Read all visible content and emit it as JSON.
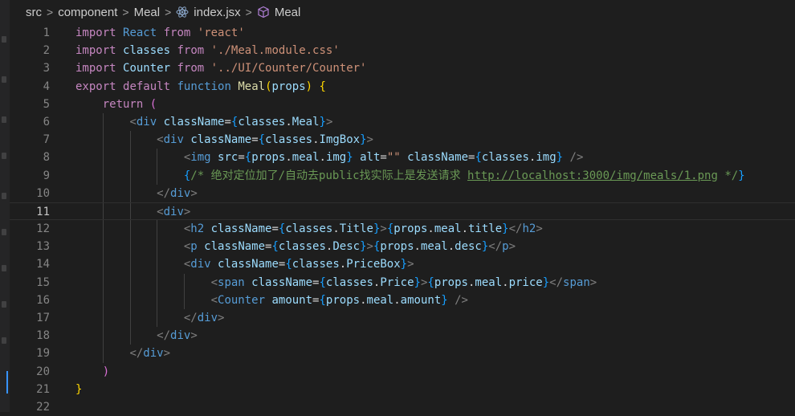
{
  "breadcrumb": {
    "items": [
      "src",
      "component",
      "Meal",
      "index.jsx",
      "Meal"
    ]
  },
  "editor": {
    "current_line": 11,
    "line_numbers": [
      "1",
      "2",
      "3",
      "4",
      "5",
      "6",
      "7",
      "8",
      "9",
      "10",
      "11",
      "12",
      "13",
      "14",
      "15",
      "16",
      "17",
      "18",
      "19",
      "20",
      "21",
      "22"
    ],
    "lines": [
      [
        [
          "kw",
          "import"
        ],
        [
          "plain",
          " "
        ],
        [
          "kw2",
          "React"
        ],
        [
          "plain",
          " "
        ],
        [
          "kw",
          "from"
        ],
        [
          "plain",
          " "
        ],
        [
          "str",
          "'react'"
        ]
      ],
      [
        [
          "kw",
          "import"
        ],
        [
          "plain",
          " "
        ],
        [
          "var",
          "classes"
        ],
        [
          "plain",
          " "
        ],
        [
          "kw",
          "from"
        ],
        [
          "plain",
          " "
        ],
        [
          "str",
          "'./Meal.module.css'"
        ]
      ],
      [
        [
          "kw",
          "import"
        ],
        [
          "plain",
          " "
        ],
        [
          "var",
          "Counter"
        ],
        [
          "plain",
          " "
        ],
        [
          "kw",
          "from"
        ],
        [
          "plain",
          " "
        ],
        [
          "str",
          "'../UI/Counter/Counter'"
        ]
      ],
      [
        [
          "kw",
          "export"
        ],
        [
          "plain",
          " "
        ],
        [
          "kw",
          "default"
        ],
        [
          "plain",
          " "
        ],
        [
          "kw2",
          "function"
        ],
        [
          "plain",
          " "
        ],
        [
          "fn",
          "Meal"
        ],
        [
          "p1",
          "("
        ],
        [
          "var",
          "props"
        ],
        [
          "p1",
          ")"
        ],
        [
          "plain",
          " "
        ],
        [
          "p1",
          "{"
        ]
      ],
      [
        [
          "plain",
          "    "
        ],
        [
          "kw",
          "return"
        ],
        [
          "plain",
          " "
        ],
        [
          "p2",
          "("
        ]
      ],
      [
        [
          "plain",
          "        "
        ],
        [
          "br",
          "<"
        ],
        [
          "tag",
          "div"
        ],
        [
          "plain",
          " "
        ],
        [
          "attr",
          "className"
        ],
        [
          "plain",
          "="
        ],
        [
          "p3",
          "{"
        ],
        [
          "var",
          "classes"
        ],
        [
          "plain",
          "."
        ],
        [
          "var",
          "Meal"
        ],
        [
          "p3",
          "}"
        ],
        [
          "br",
          ">"
        ]
      ],
      [
        [
          "plain",
          "            "
        ],
        [
          "br",
          "<"
        ],
        [
          "tag",
          "div"
        ],
        [
          "plain",
          " "
        ],
        [
          "attr",
          "className"
        ],
        [
          "plain",
          "="
        ],
        [
          "p3",
          "{"
        ],
        [
          "var",
          "classes"
        ],
        [
          "plain",
          "."
        ],
        [
          "var",
          "ImgBox"
        ],
        [
          "p3",
          "}"
        ],
        [
          "br",
          ">"
        ]
      ],
      [
        [
          "plain",
          "                "
        ],
        [
          "br",
          "<"
        ],
        [
          "tag",
          "img"
        ],
        [
          "plain",
          " "
        ],
        [
          "attr",
          "src"
        ],
        [
          "plain",
          "="
        ],
        [
          "p3",
          "{"
        ],
        [
          "var",
          "props"
        ],
        [
          "plain",
          "."
        ],
        [
          "var",
          "meal"
        ],
        [
          "plain",
          "."
        ],
        [
          "var",
          "img"
        ],
        [
          "p3",
          "}"
        ],
        [
          "plain",
          " "
        ],
        [
          "attr",
          "alt"
        ],
        [
          "plain",
          "="
        ],
        [
          "str",
          "\"\""
        ],
        [
          "plain",
          " "
        ],
        [
          "attr",
          "className"
        ],
        [
          "plain",
          "="
        ],
        [
          "p3",
          "{"
        ],
        [
          "var",
          "classes"
        ],
        [
          "plain",
          "."
        ],
        [
          "var",
          "img"
        ],
        [
          "p3",
          "}"
        ],
        [
          "plain",
          " "
        ],
        [
          "br",
          "/>"
        ]
      ],
      [
        [
          "plain",
          "                "
        ],
        [
          "p3",
          "{"
        ],
        [
          "cm",
          "/* 绝对定位加了/自动去public找实际上是发送请求 "
        ],
        [
          "url",
          "http://localhost:3000/img/meals/1.png"
        ],
        [
          "cm",
          " */"
        ],
        [
          "p3",
          "}"
        ]
      ],
      [
        [
          "plain",
          "            "
        ],
        [
          "br",
          "</"
        ],
        [
          "tag",
          "div"
        ],
        [
          "br",
          ">"
        ]
      ],
      [
        [
          "plain",
          "            "
        ],
        [
          "br",
          "<"
        ],
        [
          "tag",
          "div"
        ],
        [
          "br",
          ">"
        ]
      ],
      [
        [
          "plain",
          "                "
        ],
        [
          "br",
          "<"
        ],
        [
          "tag",
          "h2"
        ],
        [
          "plain",
          " "
        ],
        [
          "attr",
          "className"
        ],
        [
          "plain",
          "="
        ],
        [
          "p3",
          "{"
        ],
        [
          "var",
          "classes"
        ],
        [
          "plain",
          "."
        ],
        [
          "var",
          "Title"
        ],
        [
          "p3",
          "}"
        ],
        [
          "br",
          ">"
        ],
        [
          "p3",
          "{"
        ],
        [
          "var",
          "props"
        ],
        [
          "plain",
          "."
        ],
        [
          "var",
          "meal"
        ],
        [
          "plain",
          "."
        ],
        [
          "var",
          "title"
        ],
        [
          "p3",
          "}"
        ],
        [
          "br",
          "</"
        ],
        [
          "tag",
          "h2"
        ],
        [
          "br",
          ">"
        ]
      ],
      [
        [
          "plain",
          "                "
        ],
        [
          "br",
          "<"
        ],
        [
          "tag",
          "p"
        ],
        [
          "plain",
          " "
        ],
        [
          "attr",
          "className"
        ],
        [
          "plain",
          "="
        ],
        [
          "p3",
          "{"
        ],
        [
          "var",
          "classes"
        ],
        [
          "plain",
          "."
        ],
        [
          "var",
          "Desc"
        ],
        [
          "p3",
          "}"
        ],
        [
          "br",
          ">"
        ],
        [
          "p3",
          "{"
        ],
        [
          "var",
          "props"
        ],
        [
          "plain",
          "."
        ],
        [
          "var",
          "meal"
        ],
        [
          "plain",
          "."
        ],
        [
          "var",
          "desc"
        ],
        [
          "p3",
          "}"
        ],
        [
          "br",
          "</"
        ],
        [
          "tag",
          "p"
        ],
        [
          "br",
          ">"
        ]
      ],
      [
        [
          "plain",
          "                "
        ],
        [
          "br",
          "<"
        ],
        [
          "tag",
          "div"
        ],
        [
          "plain",
          " "
        ],
        [
          "attr",
          "className"
        ],
        [
          "plain",
          "="
        ],
        [
          "p3",
          "{"
        ],
        [
          "var",
          "classes"
        ],
        [
          "plain",
          "."
        ],
        [
          "var",
          "PriceBox"
        ],
        [
          "p3",
          "}"
        ],
        [
          "br",
          ">"
        ]
      ],
      [
        [
          "plain",
          "                    "
        ],
        [
          "br",
          "<"
        ],
        [
          "tag",
          "span"
        ],
        [
          "plain",
          " "
        ],
        [
          "attr",
          "className"
        ],
        [
          "plain",
          "="
        ],
        [
          "p3",
          "{"
        ],
        [
          "var",
          "classes"
        ],
        [
          "plain",
          "."
        ],
        [
          "var",
          "Price"
        ],
        [
          "p3",
          "}"
        ],
        [
          "br",
          ">"
        ],
        [
          "p3",
          "{"
        ],
        [
          "var",
          "props"
        ],
        [
          "plain",
          "."
        ],
        [
          "var",
          "meal"
        ],
        [
          "plain",
          "."
        ],
        [
          "var",
          "price"
        ],
        [
          "p3",
          "}"
        ],
        [
          "br",
          "</"
        ],
        [
          "tag",
          "span"
        ],
        [
          "br",
          ">"
        ]
      ],
      [
        [
          "plain",
          "                    "
        ],
        [
          "br",
          "<"
        ],
        [
          "kw2",
          "Counter"
        ],
        [
          "plain",
          " "
        ],
        [
          "attr",
          "amount"
        ],
        [
          "plain",
          "="
        ],
        [
          "p3",
          "{"
        ],
        [
          "var",
          "props"
        ],
        [
          "plain",
          "."
        ],
        [
          "var",
          "meal"
        ],
        [
          "plain",
          "."
        ],
        [
          "var",
          "amount"
        ],
        [
          "p3",
          "}"
        ],
        [
          "plain",
          " "
        ],
        [
          "br",
          "/>"
        ]
      ],
      [
        [
          "plain",
          "                "
        ],
        [
          "br",
          "</"
        ],
        [
          "tag",
          "div"
        ],
        [
          "br",
          ">"
        ]
      ],
      [
        [
          "plain",
          "            "
        ],
        [
          "br",
          "</"
        ],
        [
          "tag",
          "div"
        ],
        [
          "br",
          ">"
        ]
      ],
      [
        [
          "plain",
          "        "
        ],
        [
          "br",
          "</"
        ],
        [
          "tag",
          "div"
        ],
        [
          "br",
          ">"
        ]
      ],
      [
        [
          "plain",
          "    "
        ],
        [
          "p2",
          ")"
        ]
      ],
      [
        [
          "p1",
          "}"
        ]
      ],
      []
    ]
  }
}
